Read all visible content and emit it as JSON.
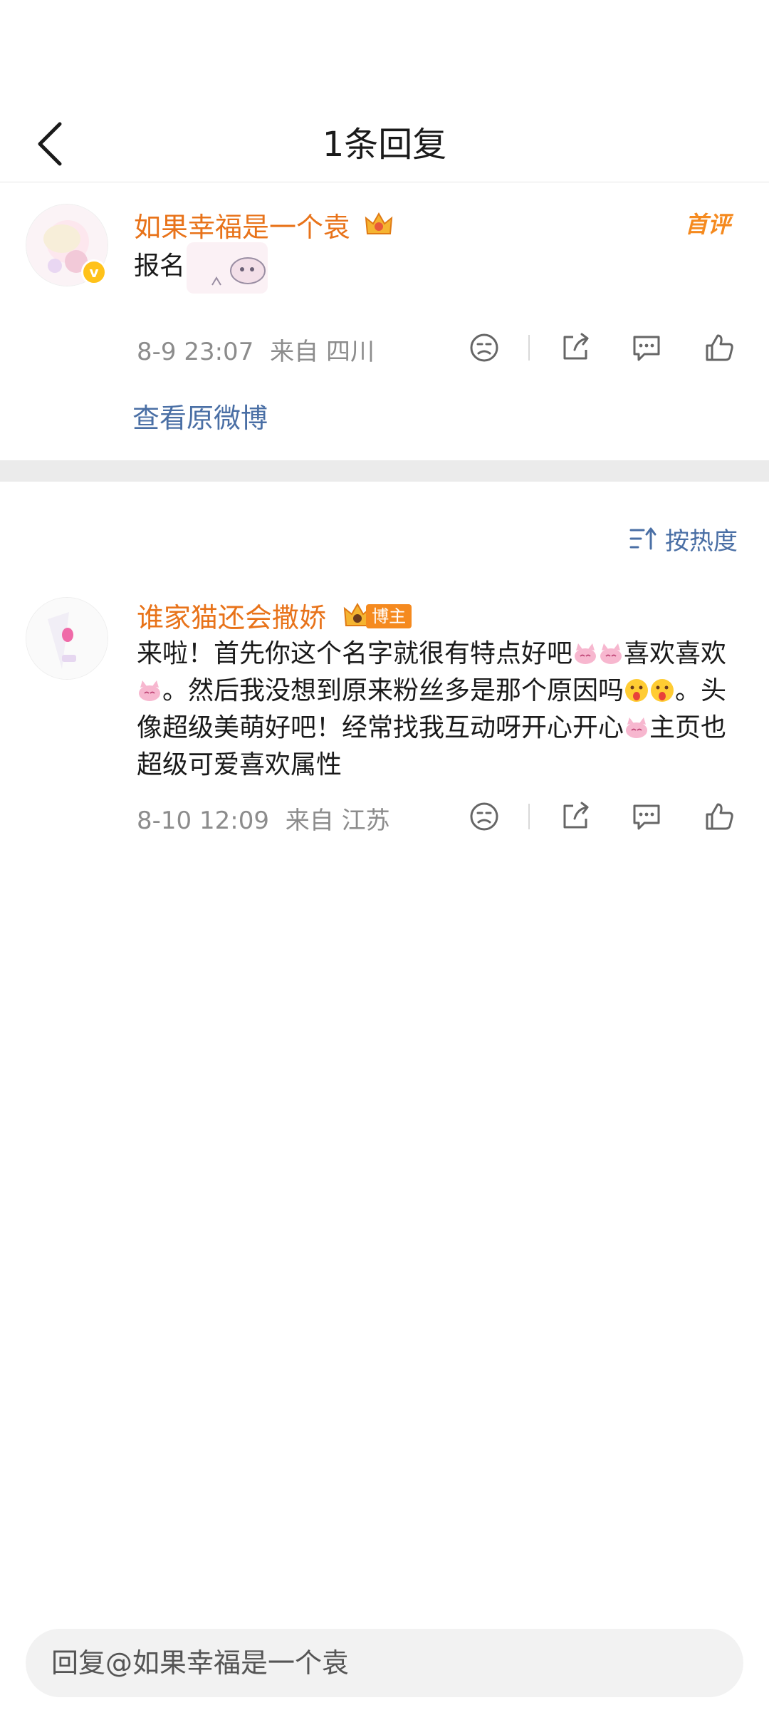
{
  "nav": {
    "title": "1条回复"
  },
  "original_comment": {
    "username": "如果幸福是一个袁",
    "text": "报名",
    "time": "8-9 23:07",
    "location": "来自 四川",
    "first_badge": "首评",
    "view_original": "查看原微博"
  },
  "sort": {
    "label": "按热度"
  },
  "reply": {
    "username": "谁家猫还会撒娇",
    "badge": "博主",
    "segments": [
      "来啦！首先你这个名字就很有特点好吧",
      "喜欢喜欢",
      "。然后我没想到原来粉丝多是那个原因吗",
      "。头像超级美萌好吧！经常找我互动呀开心开心",
      "主页也超级可爱喜欢属性"
    ],
    "time": "8-10 12:09",
    "location": "来自 江苏"
  },
  "reply_bar": {
    "placeholder": "回复@如果幸福是一个袁"
  },
  "colors": {
    "username": "#e8731a",
    "link": "#4a6fa5",
    "meta": "#8c8c8c"
  },
  "icons": [
    "back-arrow-icon",
    "dislike-face-icon",
    "share-icon",
    "comment-icon",
    "like-thumb-icon",
    "sort-icon",
    "crown-icon"
  ]
}
